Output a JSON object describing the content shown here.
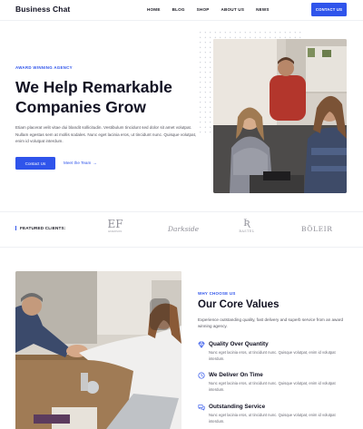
{
  "header": {
    "brand": "Business Chat",
    "nav": [
      {
        "label": "HOME"
      },
      {
        "label": "BLOG"
      },
      {
        "label": "SHOP"
      },
      {
        "label": "ABOUT US"
      },
      {
        "label": "NEWS"
      }
    ],
    "contact_label": "CONTACT US"
  },
  "hero": {
    "eyebrow": "AWARD WINNING AGENCY",
    "title_line1": "We Help Remarkable",
    "title_line2": "Companies Grow",
    "text": "Etiam placerat velit vitae dui blandit sollicitudin. Vestibulum tincidunt sed dolor sit amet volutpat. Nullam egestas sem at mollis sodales. Nunc eget lacinia eros, ut tincidunt nunc. Quisque volutpat, enim id volutpat interdum.",
    "primary_button": "Contact Us",
    "secondary_link": "Meet the Team",
    "secondary_arrow": "→"
  },
  "clients": {
    "label": "FEATURED CLIENTS:",
    "logos": [
      {
        "mark": "ЕF",
        "sub": "EMERSON"
      },
      {
        "mark": "Darkside"
      },
      {
        "mark": "Ʀ",
        "sub": "BASTEL"
      },
      {
        "mark": "BÖLEIR"
      }
    ]
  },
  "values": {
    "eyebrow": "WHY CHOOSE US",
    "title": "Our Core Values",
    "text": "Experience outstanding quality, fast delivery and superb service from an award winning agency.",
    "features": [
      {
        "icon": "diamond-icon",
        "title": "Quality Over Quantity",
        "desc": "Nunc eget lacinia eros, ut tincidunt nunc. Quisque volutpat, enim id volutpat interdum."
      },
      {
        "icon": "clock-icon",
        "title": "We Deliver On Time",
        "desc": "Nunc eget lacinia eros, ut tincidunt nunc. Quisque volutpat, enim id volutpat interdum."
      },
      {
        "icon": "chat-icon",
        "title": "Outstanding Service",
        "desc": "Nunc eget lacinia eros, ut tincidunt nunc. Quisque volutpat, enim id volutpat interdum."
      }
    ]
  },
  "colors": {
    "accent": "#2f54eb",
    "heading": "#111122",
    "body": "#54545e"
  }
}
